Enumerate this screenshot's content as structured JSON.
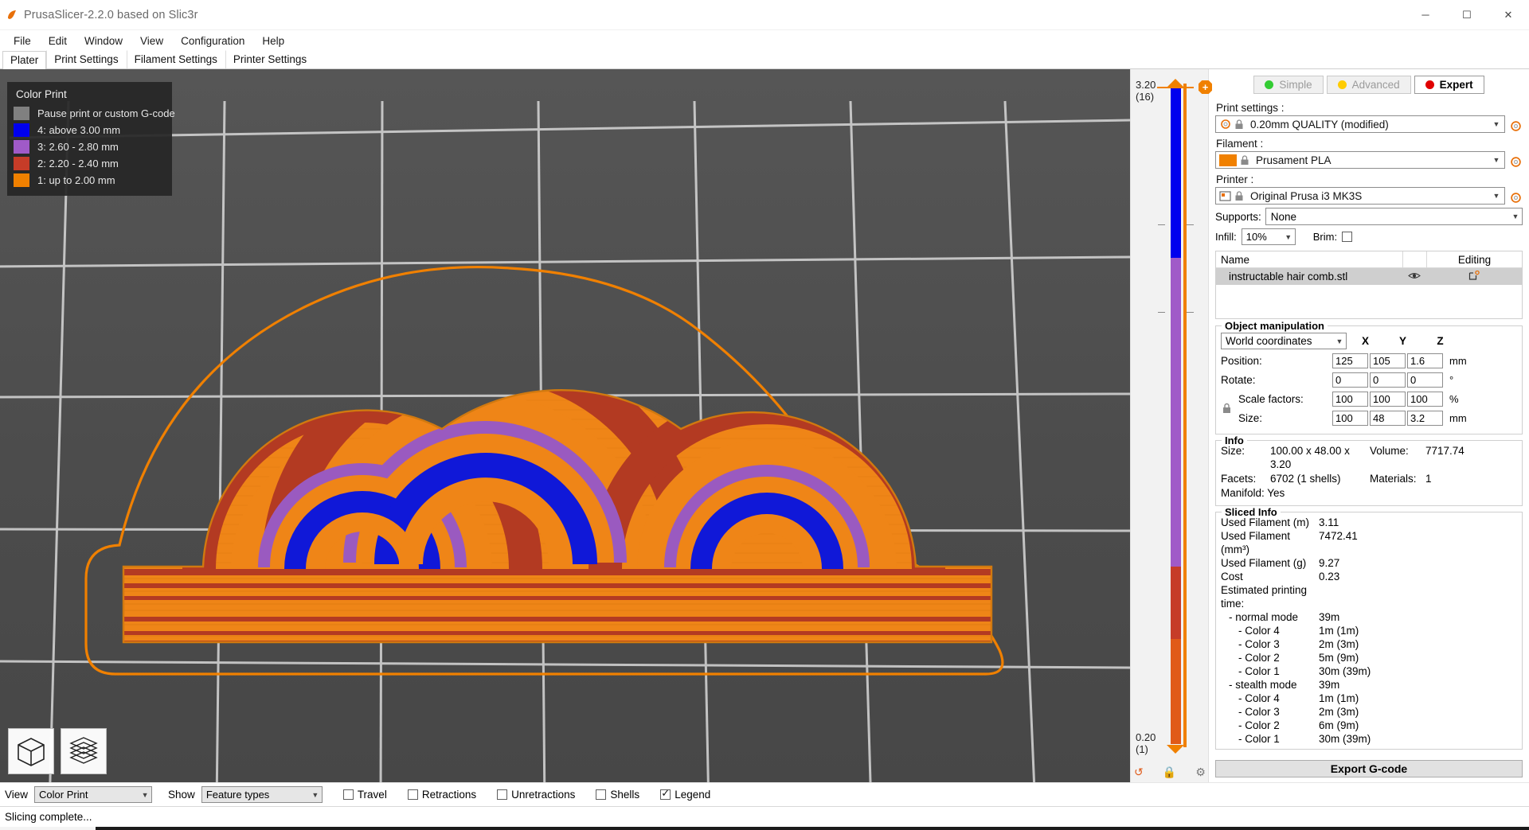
{
  "window": {
    "title": "PrusaSlicer-2.2.0 based on Slic3r",
    "minimize": "─",
    "maximize": "☐",
    "close": "✕"
  },
  "menu": [
    "File",
    "Edit",
    "Window",
    "View",
    "Configuration",
    "Help"
  ],
  "tabs": [
    {
      "label": "Plater",
      "active": true
    },
    {
      "label": "Print Settings",
      "active": false
    },
    {
      "label": "Filament Settings",
      "active": false
    },
    {
      "label": "Printer Settings",
      "active": false
    }
  ],
  "legend": {
    "title": "Color Print",
    "items": [
      {
        "color": "#808080",
        "label": "Pause print or custom G-code"
      },
      {
        "color": "#0000ee",
        "label": "4: above 3.00 mm"
      },
      {
        "color": "#a05ac8",
        "label": "3: 2.60 - 2.80 mm"
      },
      {
        "color": "#c63c28",
        "label": "2: 2.20 - 2.40 mm"
      },
      {
        "color": "#f08000",
        "label": "1: up to 2.00 mm"
      }
    ]
  },
  "slider": {
    "top_value": "3.20",
    "top_layer": "(16)",
    "bottom_value": "0.20",
    "bottom_layer": "(1)",
    "add_label": "+",
    "revert_icon": "↺",
    "lock_icon": "■",
    "gear_icon": "⚙",
    "segments": [
      {
        "color": "#0000ee",
        "top_pct": 0,
        "height_pct": 26
      },
      {
        "color": "#a05ac8",
        "top_pct": 26,
        "height_pct": 47
      },
      {
        "color": "#c63c28",
        "top_pct": 73,
        "height_pct": 11
      },
      {
        "color": "#f08000",
        "top_pct": 84,
        "height_pct": 16
      }
    ]
  },
  "modes": [
    {
      "label": "Simple",
      "color": "#33cc33",
      "active": false
    },
    {
      "label": "Advanced",
      "color": "#ffcc00",
      "active": false
    },
    {
      "label": "Expert",
      "color": "#e00000",
      "active": true
    }
  ],
  "settings": {
    "print_label": "Print settings :",
    "print_value": "0.20mm QUALITY (modified)",
    "filament_label": "Filament :",
    "filament_value": "Prusament PLA",
    "filament_color": "#f08000",
    "printer_label": "Printer :",
    "printer_value": "Original Prusa i3 MK3S",
    "supports_label": "Supports:",
    "supports_value": "None",
    "infill_label": "Infill:",
    "infill_value": "10%",
    "brim_label": "Brim:",
    "brim_checked": false
  },
  "objlist": {
    "col_name": "Name",
    "col_editing": "Editing",
    "rows": [
      {
        "name": "instructable hair comb.stl",
        "eye_icon": "eye-icon",
        "edit_icon": "edit-icon"
      }
    ]
  },
  "manipulation": {
    "title": "Object manipulation",
    "coord_system": "World coordinates",
    "axes": [
      "X",
      "Y",
      "Z"
    ],
    "rows": [
      {
        "label": "Position:",
        "values": [
          "125",
          "105",
          "1.6"
        ],
        "unit": "mm",
        "indent": false
      },
      {
        "label": "Rotate:",
        "values": [
          "0",
          "0",
          "0"
        ],
        "unit": "°",
        "indent": false
      },
      {
        "label": "Scale factors:",
        "values": [
          "100",
          "100",
          "100"
        ],
        "unit": "%",
        "indent": true
      },
      {
        "label": "Size:",
        "values": [
          "100",
          "48",
          "3.2"
        ],
        "unit": "mm",
        "indent": true
      }
    ]
  },
  "info": {
    "title": "Info",
    "size_label": "Size:",
    "size_value": "100.00 x 48.00 x 3.20",
    "volume_label": "Volume:",
    "volume_value": "7717.74",
    "facets_label": "Facets:",
    "facets_value": "6702 (1 shells)",
    "materials_label": "Materials:",
    "materials_value": "1",
    "manifold_label": "Manifold: Yes"
  },
  "sliced_info": {
    "title": "Sliced Info",
    "rows": [
      {
        "key": "Used Filament (m)",
        "value": "3.11",
        "indent": 0
      },
      {
        "key": "Used Filament (mm³)",
        "value": "7472.41",
        "indent": 0
      },
      {
        "key": "Used Filament (g)",
        "value": "9.27",
        "indent": 0
      },
      {
        "key": "Cost",
        "value": "0.23",
        "indent": 0
      },
      {
        "key": "Estimated printing time:",
        "value": "",
        "indent": 0
      },
      {
        "key": "- normal mode",
        "value": "39m",
        "indent": 1
      },
      {
        "key": "- Color 4",
        "value": "1m (1m)",
        "indent": 2
      },
      {
        "key": "- Color 3",
        "value": "2m (3m)",
        "indent": 2
      },
      {
        "key": "- Color 2",
        "value": "5m (9m)",
        "indent": 2
      },
      {
        "key": "- Color 1",
        "value": "30m (39m)",
        "indent": 2
      },
      {
        "key": "- stealth mode",
        "value": "39m",
        "indent": 1
      },
      {
        "key": "- Color 4",
        "value": "1m (1m)",
        "indent": 2
      },
      {
        "key": "- Color 3",
        "value": "2m (3m)",
        "indent": 2
      },
      {
        "key": "- Color 2",
        "value": "6m (9m)",
        "indent": 2
      },
      {
        "key": "- Color 1",
        "value": "30m (39m)",
        "indent": 2
      }
    ]
  },
  "export": {
    "label": "Export G-code"
  },
  "viewbar": {
    "view_label": "View",
    "view_value": "Color Print",
    "show_label": "Show",
    "show_value": "Feature types",
    "checkboxes": [
      {
        "label": "Travel",
        "checked": false
      },
      {
        "label": "Retractions",
        "checked": false
      },
      {
        "label": "Unretractions",
        "checked": false
      },
      {
        "label": "Shells",
        "checked": false
      },
      {
        "label": "Legend",
        "checked": true
      }
    ]
  },
  "status": {
    "text": "Slicing complete..."
  }
}
